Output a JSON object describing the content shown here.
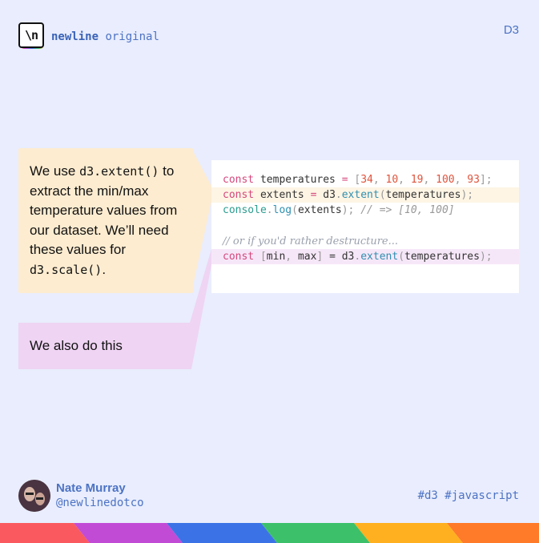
{
  "brand": {
    "logo_text": "\\n",
    "name_bold": "newline",
    "name_light": "original"
  },
  "corner_tag": "D3",
  "notes": {
    "first": {
      "t1": "We use ",
      "code1": "d3.extent()",
      "t2": " to extract the min/max temperature values from our dataset. We’ll need these values for ",
      "code2": "d3.scale()",
      "t3": "."
    },
    "second": "We also do this"
  },
  "code": {
    "line1": {
      "kw": "const",
      "name": " temperatures ",
      "eq": "=",
      "sp": " ",
      "open": "[",
      "n1": "34",
      "c1": ", ",
      "n2": "10",
      "c2": ", ",
      "n3": "19",
      "c3": ", ",
      "n4": "100",
      "c4": ", ",
      "n5": "93",
      "close": "];"
    },
    "line2": {
      "kw": "const",
      "name": " extents ",
      "eq": "=",
      "obj": " d3",
      "dot": ".",
      "fn": "extent",
      "open": "(",
      "arg": "temperatures",
      "close": ");"
    },
    "line3": {
      "obj": "console",
      "dot": ".",
      "fn": "log",
      "open": "(",
      "arg": "extents",
      "close": ");",
      "comment": " // => [10, 100]"
    },
    "line4": {
      "comment": "// or if you'd rather destructure..."
    },
    "line5": {
      "kw": "const",
      "sp": " ",
      "open": "[",
      "a": "min",
      "comma": ", ",
      "b": "max",
      "close": "]",
      "eq": " = ",
      "obj": "d3",
      "dot": ".",
      "fn": "extent",
      "popen": "(",
      "arg": "temperatures",
      "pclose": ");"
    }
  },
  "author": {
    "name": "Nate Murray",
    "handle": "@newlinedotco"
  },
  "hashtags": "#d3 #javascript",
  "colors": {
    "background": "#e9edfd",
    "note_yellow": "#fdecd0",
    "note_pink": "#efd4f3",
    "accent_blue": "#4d73c4",
    "rainbow": [
      "#fa5a5f",
      "#c24bd6",
      "#3b73e6",
      "#3cc16a",
      "#ffb020",
      "#ff7a29"
    ]
  }
}
